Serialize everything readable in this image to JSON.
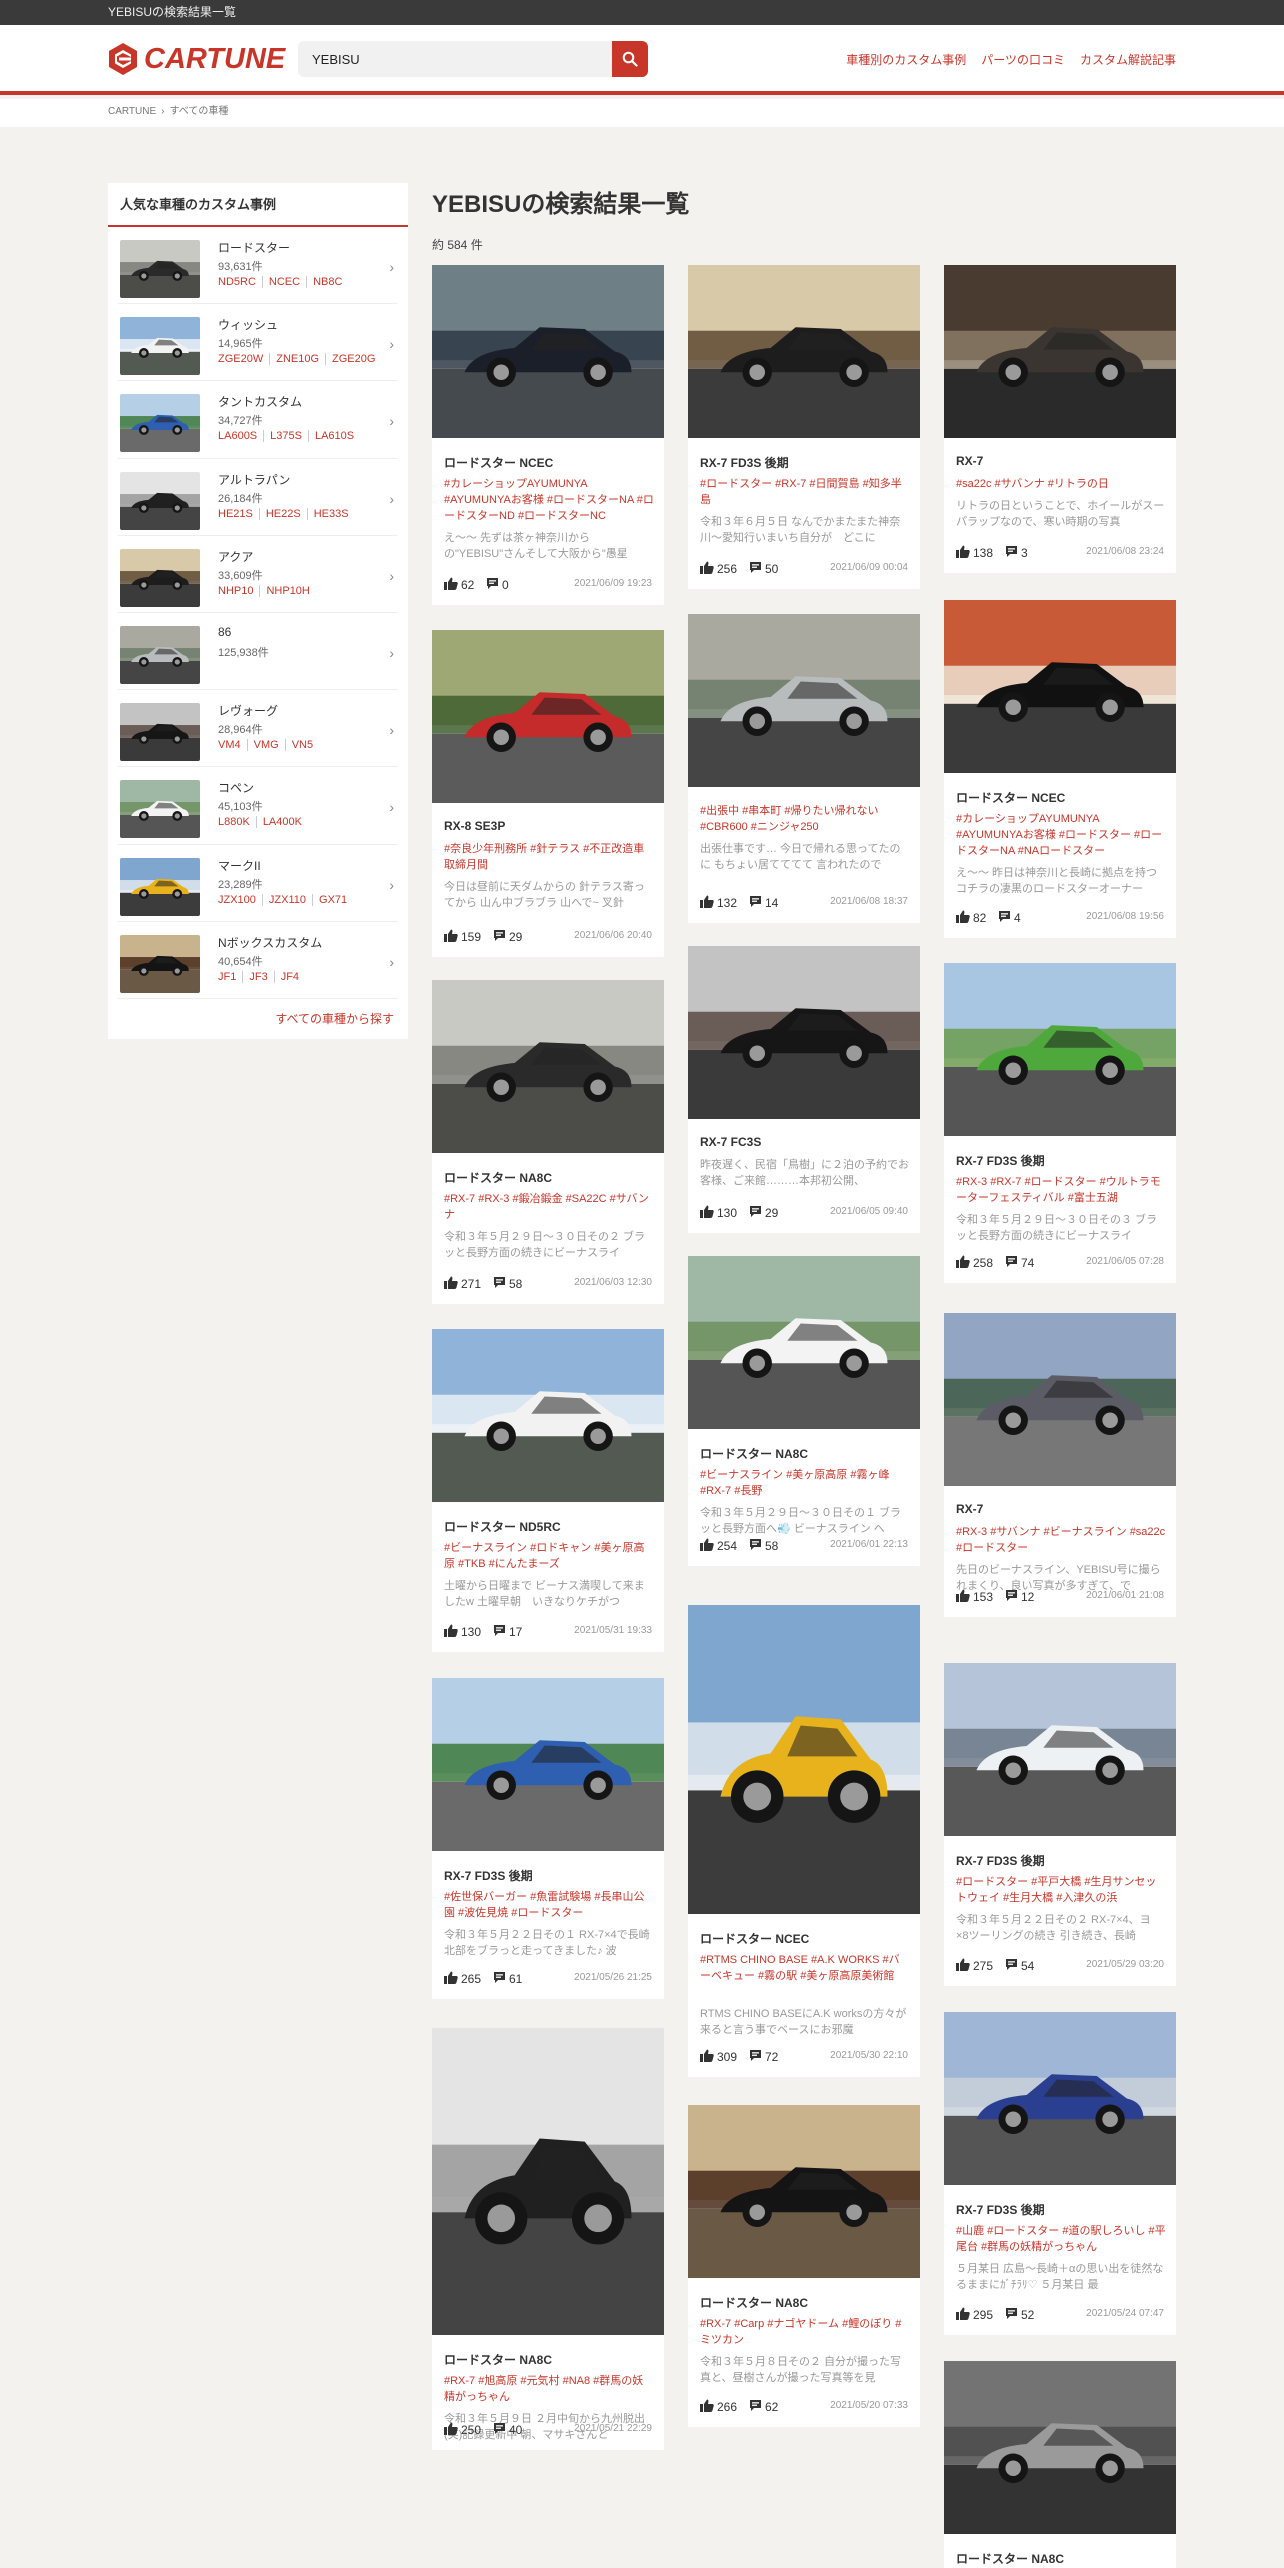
{
  "topbar": {
    "text": "YEBISUの検索結果一覧"
  },
  "header": {
    "logo_text": "CARTUNE",
    "search_value": "YEBISU",
    "nav": [
      "車種別のカスタム事例",
      "パーツの口コミ",
      "カスタム解説記事"
    ]
  },
  "breadcrumb": [
    "CARTUNE",
    "すべての車種"
  ],
  "sidebar": {
    "title": "人気な車種のカスタム事例",
    "items": [
      {
        "name": "ロードスター",
        "count": "93,631件",
        "tags": [
          "ND5RC",
          "NCEC",
          "NB8C"
        ]
      },
      {
        "name": "ウィッシュ",
        "count": "14,965件",
        "tags": [
          "ZGE20W",
          "ZNE10G",
          "ZGE20G"
        ]
      },
      {
        "name": "タントカスタム",
        "count": "34,727件",
        "tags": [
          "LA600S",
          "L375S",
          "LA610S"
        ]
      },
      {
        "name": "アルトラパン",
        "count": "26,184件",
        "tags": [
          "HE21S",
          "HE22S",
          "HE33S"
        ]
      },
      {
        "name": "アクア",
        "count": "33,609件",
        "tags": [
          "NHP10",
          "NHP10H"
        ]
      },
      {
        "name": "86",
        "count": "125,938件",
        "tags": []
      },
      {
        "name": "レヴォーグ",
        "count": "28,964件",
        "tags": [
          "VM4",
          "VMG",
          "VN5"
        ]
      },
      {
        "name": "コペン",
        "count": "45,103件",
        "tags": [
          "L880K",
          "LA400K"
        ]
      },
      {
        "name": "マークII",
        "count": "23,289件",
        "tags": [
          "JZX100",
          "JZX110",
          "GX71"
        ]
      },
      {
        "name": "Nボックスカスタム",
        "count": "40,654件",
        "tags": [
          "JF1",
          "JF3",
          "JF4"
        ]
      }
    ],
    "all_link": "すべての車種から探す"
  },
  "main": {
    "title": "YEBISUの検索結果一覧",
    "count": "約 584 件"
  },
  "cards": [
    {
      "title": "ロードスター NCEC",
      "tags": "#カレーショップAYUMUNYA #AYUMUNYAお客様 #ロードスターNA #ロードスターND #ロードスターNC",
      "desc": "え～～ 先ずは茶ヶ神奈川から の\"YEBISU\"さんそして大阪から\"愚星",
      "likes": "62",
      "comments": "0",
      "date": "2021/06/09 19:23"
    },
    {
      "title": "RX-8 SE3P",
      "tags": "#奈良少年刑務所 #針テラス #不正改造車取締月間",
      "desc": "今日は昼前に天ダムからの 針テラス寄ってから 山ん中ブラブラ 山へで~ 叉針",
      "likes": "159",
      "comments": "29",
      "date": "2021/06/06 20:40"
    },
    {
      "title": "ロードスター NA8C",
      "tags": "#RX-7 #RX-3 #鍛冶鍛金 #SA22C #サバンナ",
      "desc": "令和３年５月２９日～３０日その２ ブラッと長野方面の続きにビーナスライ",
      "likes": "271",
      "comments": "58",
      "date": "2021/06/03 12:30"
    },
    {
      "title": "ロードスター ND5RC",
      "tags": "#ビーナスライン #ロドキャン #美ヶ原高原 #TKB #にんたまーズ",
      "desc": "土曜から日曜まで ビーナス満喫して来ましたw 土曜早朝　いきなりケチがつ",
      "likes": "130",
      "comments": "17",
      "date": "2021/05/31 19:33"
    },
    {
      "title": "RX-7 FD3S 後期",
      "tags": "#佐世保バーガー #魚雷試験場 #長串山公園 #波佐見焼 #ロードスター",
      "desc": "令和３年５月２２日その１ RX-7×4で長崎北部をブラっと走ってきました♪ 波",
      "likes": "265",
      "comments": "61",
      "date": "2021/05/26 21:25"
    },
    {
      "title": "ロードスター NA8C",
      "tags": "#RX-7 #旭高原 #元気村 #NA8 #群馬の妖精がっちゃん",
      "desc": "令和３年５月９日 ２月中旬から九州脱出(笑)記録更新中 朝、マサキさんと",
      "likes": "250",
      "comments": "40",
      "date": "2021/05/21 22:29"
    },
    {
      "title": "RX-7 FD3S 後期",
      "tags": "#ロードスター #RX-7 #日間賀島 #知多半島",
      "desc": "令和３年６月５日 なんでかまたまた神奈川～愛知行いまいち自分が　どこに",
      "likes": "256",
      "comments": "50",
      "date": "2021/06/09 00:04"
    },
    {
      "title": "",
      "tags": "#出張中 #串本町 #帰りたい帰れない #CBR600 #ニンジャ250",
      "desc": "出張仕事です… 今日で帰れる思ってたのに もちょい居てててて 言われたので",
      "likes": "132",
      "comments": "14",
      "date": "2021/06/08 18:37"
    },
    {
      "title": "RX-7 FC3S",
      "tags": "",
      "desc": "昨夜遅く、民宿「鳥樹」に２泊の予約でお客様、ご来館………本邦初公開、",
      "likes": "130",
      "comments": "29",
      "date": "2021/06/05 09:40"
    },
    {
      "title": "ロードスター NA8C",
      "tags": "#ビーナスライン #美ヶ原高原 #霧ヶ峰 #RX-7 #長野",
      "desc": "令和３年５月２９日～３０日その１ ブラッと長野方面へ💨 ビーナスライン へ",
      "likes": "254",
      "comments": "58",
      "date": "2021/06/01 22:13"
    },
    {
      "title": "ロードスター NCEC",
      "tags": "#RTMS CHINO BASE #A.K WORKS #バーベキュー #霧の駅 #美ヶ原高原美術館",
      "desc": "RTMS CHINO BASEにA.K worksの方々が来ると言う事でベースにお邪魔",
      "likes": "309",
      "comments": "72",
      "date": "2021/05/30 22:10"
    },
    {
      "title": "ロードスター NA8C",
      "tags": "#RX-7 #Carp #ナゴヤドーム #鯉のぼり #ミツカン",
      "desc": "令和３年５月８日その２ 自分が撮った写真と、昼樹さんが撮った写真等を見",
      "likes": "266",
      "comments": "62",
      "date": "2021/05/20 07:33"
    },
    {
      "title": "RX-7",
      "tags": "#sa22c #サバンナ #リトラの日",
      "desc": "リトラの日ということで、ホイールがスーパラップなので、寒い時期の写真",
      "likes": "138",
      "comments": "3",
      "date": "2021/06/08 23:24"
    },
    {
      "title": "ロードスター NCEC",
      "tags": "#カレーショップAYUMUNYA #AYUMUNYAお客様 #ロードスター #ロードスターNA #NAロードスター",
      "desc": "え～～ 昨日は神奈川と長崎に拠点を持つコチラの凄黒のロードスターオーナー",
      "likes": "82",
      "comments": "4",
      "date": "2021/06/08 19:56"
    },
    {
      "title": "RX-7 FD3S 後期",
      "tags": "#RX-3 #RX-7 #ロードスター #ウルトラモーターフェスティバル #富士五湖",
      "desc": "令和３年５月２９日～３０日その３ ブラッと長野方面の続きにビーナスライ",
      "likes": "258",
      "comments": "74",
      "date": "2021/06/05 07:28"
    },
    {
      "title": "RX-7",
      "tags": "#RX-3 #サバンナ #ビーナスライン #sa22c #ロードスター",
      "desc": "先日のビーナスライン、YEBISU号に撮られまくり、良い写真が多すぎて、で",
      "likes": "153",
      "comments": "12",
      "date": "2021/06/01 21:08"
    },
    {
      "title": "RX-7 FD3S 後期",
      "tags": "#ロードスター #平戸大橋 #生月サンセットウェイ #生月大橋 #入津久の浜",
      "desc": "令和３年５月２２日その２ RX-7×4、ヨ ×8ツーリングの続き 引き続き、長崎",
      "likes": "275",
      "comments": "54",
      "date": "2021/05/29 03:20"
    },
    {
      "title": "RX-7 FD3S 後期",
      "tags": "#山鹿 #ロードスター #道の駅しろいし #平尾台 #群馬の妖精がっちゃん",
      "desc": "５月某日 広島～長崎＋αの思い出を徒然なるままにｶﾞﾁﾗﾘ♡ ５月某日 最",
      "likes": "295",
      "comments": "52",
      "date": "2021/05/24 07:47"
    },
    {
      "title": "ロードスター NA8C",
      "tags": "",
      "desc": "",
      "likes": "",
      "comments": "",
      "date": ""
    }
  ],
  "colors": {
    "accent": "#c8362a",
    "topbar": "#3a3a3a",
    "background": "#f4f2ef"
  },
  "icons": {
    "like": "thumbs-up-icon",
    "comment": "comment-icon",
    "search": "search-icon",
    "chevron": "chevron-right-icon"
  }
}
